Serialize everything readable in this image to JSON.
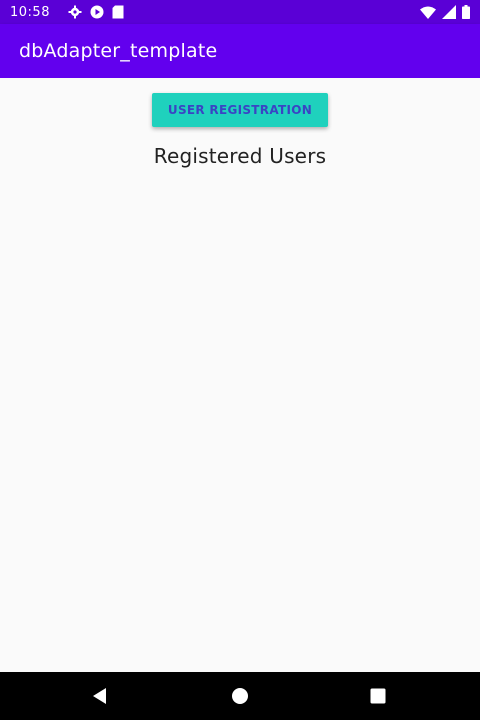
{
  "status_bar": {
    "time": "10:58",
    "left_icons": [
      "settings-icon",
      "play-protect-icon",
      "sd-card-icon"
    ],
    "right_icons": [
      "wifi-icon",
      "signal-icon",
      "battery-icon"
    ],
    "color": "#5a00d6"
  },
  "app_bar": {
    "title": "dbAdapter_template",
    "color": "#6200ee"
  },
  "main": {
    "register_button_label": "USER REGISTRATION",
    "button_color": "#1fd1bd",
    "heading": "Registered Users",
    "users": []
  },
  "nav_bar": {
    "buttons": [
      "back-icon",
      "home-icon",
      "recents-icon"
    ]
  }
}
